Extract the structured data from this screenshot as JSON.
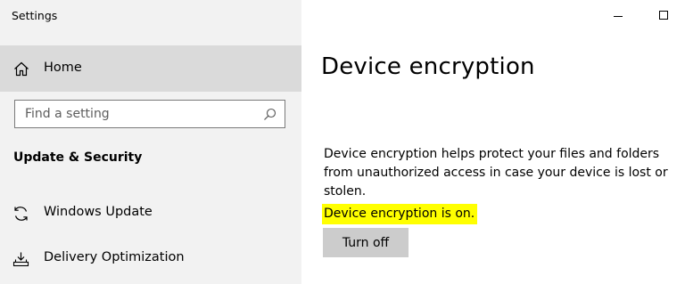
{
  "window": {
    "title": "Settings",
    "minimize_icon": "minimize-icon",
    "maximize_icon": "maximize-icon"
  },
  "sidebar": {
    "home": {
      "label": "Home",
      "icon": "home-icon"
    },
    "search": {
      "placeholder": "Find a setting",
      "value": "",
      "icon": "search-icon"
    },
    "section_title": "Update & Security",
    "items": [
      {
        "label": "Windows Update",
        "icon": "sync-icon"
      },
      {
        "label": "Delivery Optimization",
        "icon": "delivery-optimization-icon"
      }
    ]
  },
  "main": {
    "title": "Device encryption",
    "description": "Device encryption helps protect your files and folders from unauthorized access in case your device is lost or stolen.",
    "status": "Device encryption is on.",
    "status_highlight_color": "#ffff00",
    "button_label": "Turn off"
  },
  "colors": {
    "sidebar_bg": "#f2f2f2",
    "selected_bg": "#dadada",
    "button_bg": "#cccccc"
  }
}
